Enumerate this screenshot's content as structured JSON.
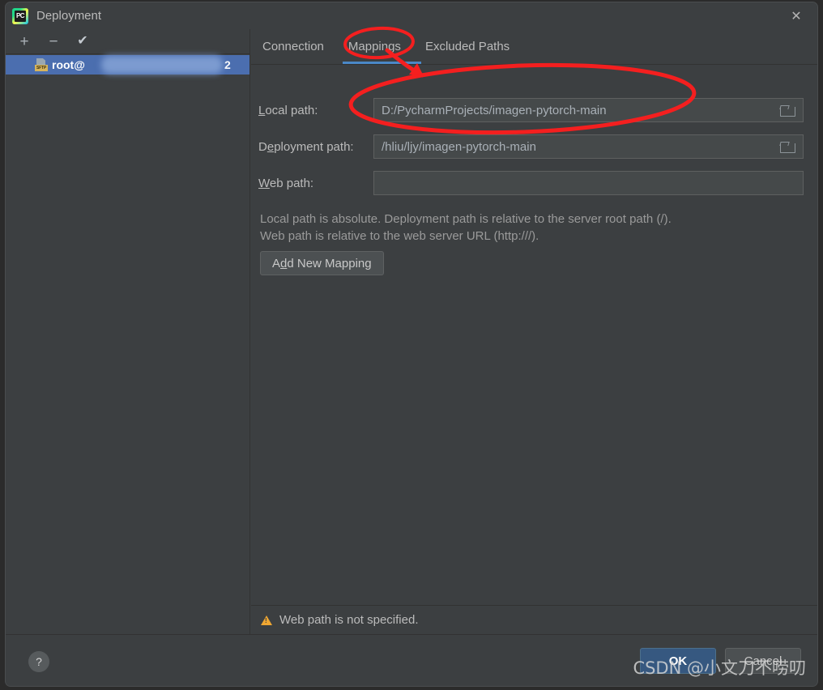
{
  "window": {
    "title": "Deployment",
    "app_icon": "pycharm-icon",
    "close_label": "✕"
  },
  "left_panel": {
    "toolbar": [
      {
        "name": "add-server-button",
        "glyph": "+"
      },
      {
        "name": "remove-server-button",
        "glyph": "−"
      },
      {
        "name": "use-as-default-button",
        "glyph": "✔"
      }
    ],
    "servers": [
      {
        "name_prefix": "root@",
        "name_suffix": "2",
        "protocol_badge": "SFTP",
        "redacted": true,
        "selected": true
      }
    ]
  },
  "tabs": [
    {
      "label": "Connection",
      "selected": false
    },
    {
      "label": "Mappings",
      "selected": true
    },
    {
      "label": "Excluded Paths",
      "selected": false
    }
  ],
  "form": {
    "rows": [
      {
        "label_pre": "",
        "label_mnemonic": "L",
        "label_post": "ocal path:",
        "value": "D:/PycharmProjects/imagen-pytorch-main",
        "placeholder": "",
        "has_browse": true
      },
      {
        "label_pre": "D",
        "label_mnemonic": "e",
        "label_post": "ployment path:",
        "value": "/hliu/ljy/imagen-pytorch-main",
        "placeholder": "",
        "has_browse": true
      },
      {
        "label_pre": "",
        "label_mnemonic": "W",
        "label_post": "eb path:",
        "value": "",
        "placeholder": "",
        "has_browse": false
      }
    ],
    "hint_line1": "Local path is absolute. Deployment path is relative to the server root path (/).",
    "hint_line2": "Web path is relative to the web server URL (http:///).",
    "add_mapping_pre": "A",
    "add_mapping_mnemonic": "d",
    "add_mapping_post": "d New Mapping"
  },
  "status": {
    "icon": "warning-icon",
    "text": "Web path is not specified."
  },
  "footer": {
    "help_glyph": "?",
    "ok_label": "OK",
    "cancel_label": "Cancel"
  },
  "watermark": "CSDN @小文刀不唠叨",
  "colors": {
    "background": "#3c3f41",
    "field_bg": "#45494a",
    "selection_blue": "#4b6eaf",
    "tab_accent": "#4a88c7",
    "ok_button": "#365880",
    "warning": "#f0a732",
    "annotation_red": "#f41f1f",
    "text": "#bbbbbb"
  }
}
